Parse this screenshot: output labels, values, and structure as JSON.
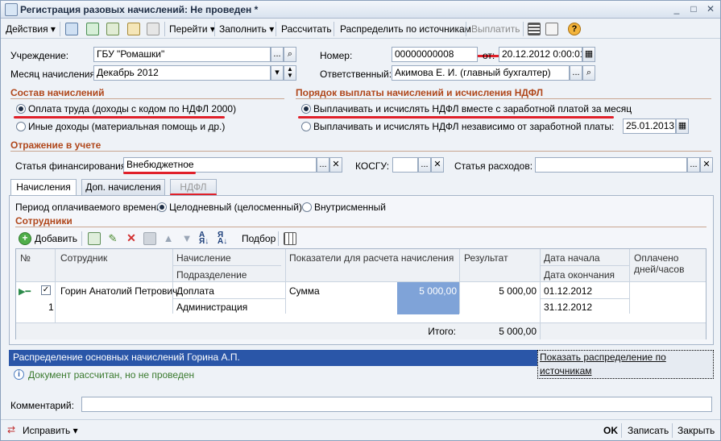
{
  "window": {
    "title": "Регистрация разовых начислений: Не проведен *"
  },
  "toolbar": {
    "actions": "Действия",
    "goto": "Перейти",
    "fill": "Заполнить",
    "calc": "Рассчитать",
    "distribute": "Распределить по источникам",
    "pay": "Выплатить",
    "help": "?"
  },
  "form": {
    "institution_label": "Учреждение:",
    "institution": "ГБУ \"Ромашки\"",
    "month_label": "Месяц начисления:",
    "month": "Декабрь 2012",
    "number_label": "Номер:",
    "number": "00000000008",
    "from_label": "от:",
    "date": "20.12.2012  0:00:01",
    "responsible_label": "Ответственный:",
    "responsible": "Акимова Е. И. (главный бухгалтер)"
  },
  "composition": {
    "title": "Состав начислений",
    "option1": "Оплата труда (доходы с кодом по НДФЛ 2000)",
    "option2": "Иные доходы (материальная помощь и др.)"
  },
  "ndfl": {
    "title": "Порядок выплаты начислений и исчисления НДФЛ",
    "option1": "Выплачивать и исчислять НДФЛ вместе с заработной платой за месяц",
    "option2": "Выплачивать и исчислять НДФЛ независимо от заработной платы:",
    "date": "25.01.2013"
  },
  "accounting": {
    "title": "Отражение в учете",
    "finance_label": "Статья финансирования:",
    "finance": "Внебюджетное",
    "kosgu_label": "КОСГУ:",
    "kosgu": "",
    "expense_label": "Статья расходов:",
    "expense": ""
  },
  "tabs": [
    "Начисления",
    "Доп. начисления",
    "НДФЛ"
  ],
  "period": {
    "label": "Период оплачиваемого времени:",
    "opt1": "Целодневный (целосменный)",
    "opt2": "Внутрисменный"
  },
  "employees": {
    "title": "Сотрудники",
    "add": "Добавить",
    "select": "Подбор"
  },
  "grid": {
    "headers": {
      "num": "№",
      "employee": "Сотрудник",
      "accrual": "Начисление",
      "department": "Подразделение",
      "indicators": "Показатели для расчета начисления",
      "result": "Результат",
      "start": "Дата начала",
      "end": "Дата окончания",
      "paid": "Оплачено дней/часов"
    },
    "row": {
      "num": "1",
      "employee": "Горин Анатолий Петрович",
      "accrual": "Доплата",
      "department": "Администрация",
      "indicator": "Сумма",
      "indicator_value": "5 000,00",
      "result": "5 000,00",
      "start": "01.12.2012",
      "end": "31.12.2012"
    },
    "total_label": "Итого:",
    "total": "5 000,00"
  },
  "distribution": {
    "title": "Распределение основных начислений Горина А.П.",
    "link": "Показать распределение по источникам"
  },
  "info": "Документ рассчитан, но не проведен",
  "comment_label": "Комментарий:",
  "comment": "",
  "status": {
    "fix": "Исправить",
    "ok": "OK",
    "save": "Записать",
    "close": "Закрыть"
  },
  "colors": {
    "section": "#b0471b",
    "highlight": "#e0202a",
    "bluebar": "#2a56a8",
    "cellblue": "#7fa3d8"
  }
}
